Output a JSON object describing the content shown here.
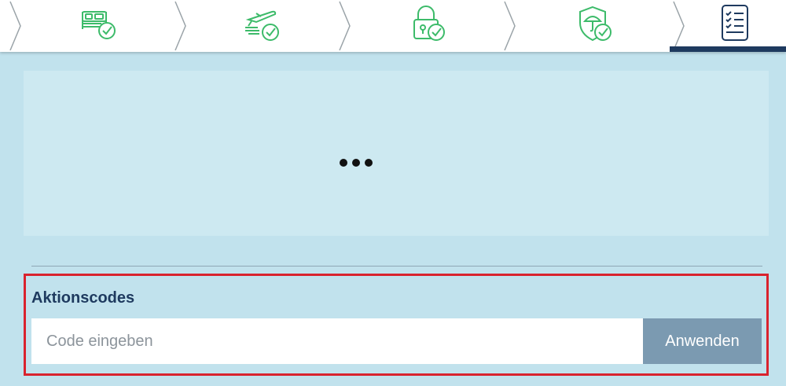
{
  "stepper": {
    "steps": [
      {
        "icon": "hotel-bed-check-icon",
        "state": "completed"
      },
      {
        "icon": "flight-check-icon",
        "state": "completed"
      },
      {
        "icon": "lock-check-icon",
        "state": "completed"
      },
      {
        "icon": "insurance-shield-check-icon",
        "state": "completed"
      },
      {
        "icon": "checklist-icon",
        "state": "active"
      }
    ],
    "colors": {
      "completed": "#3dbb6a",
      "active": "#1e3a5f"
    }
  },
  "loading": {
    "indicator": "loading-dots-icon"
  },
  "promo": {
    "title": "Aktionscodes",
    "input_value": "",
    "input_placeholder": "Code eingeben",
    "apply_label": "Anwenden"
  },
  "colors": {
    "page_background": "#c1e2ed",
    "panel_background": "#cde9f1",
    "highlight_border": "#d9232e",
    "button_background": "#7b9ab1",
    "title_color": "#1e3a5f"
  }
}
